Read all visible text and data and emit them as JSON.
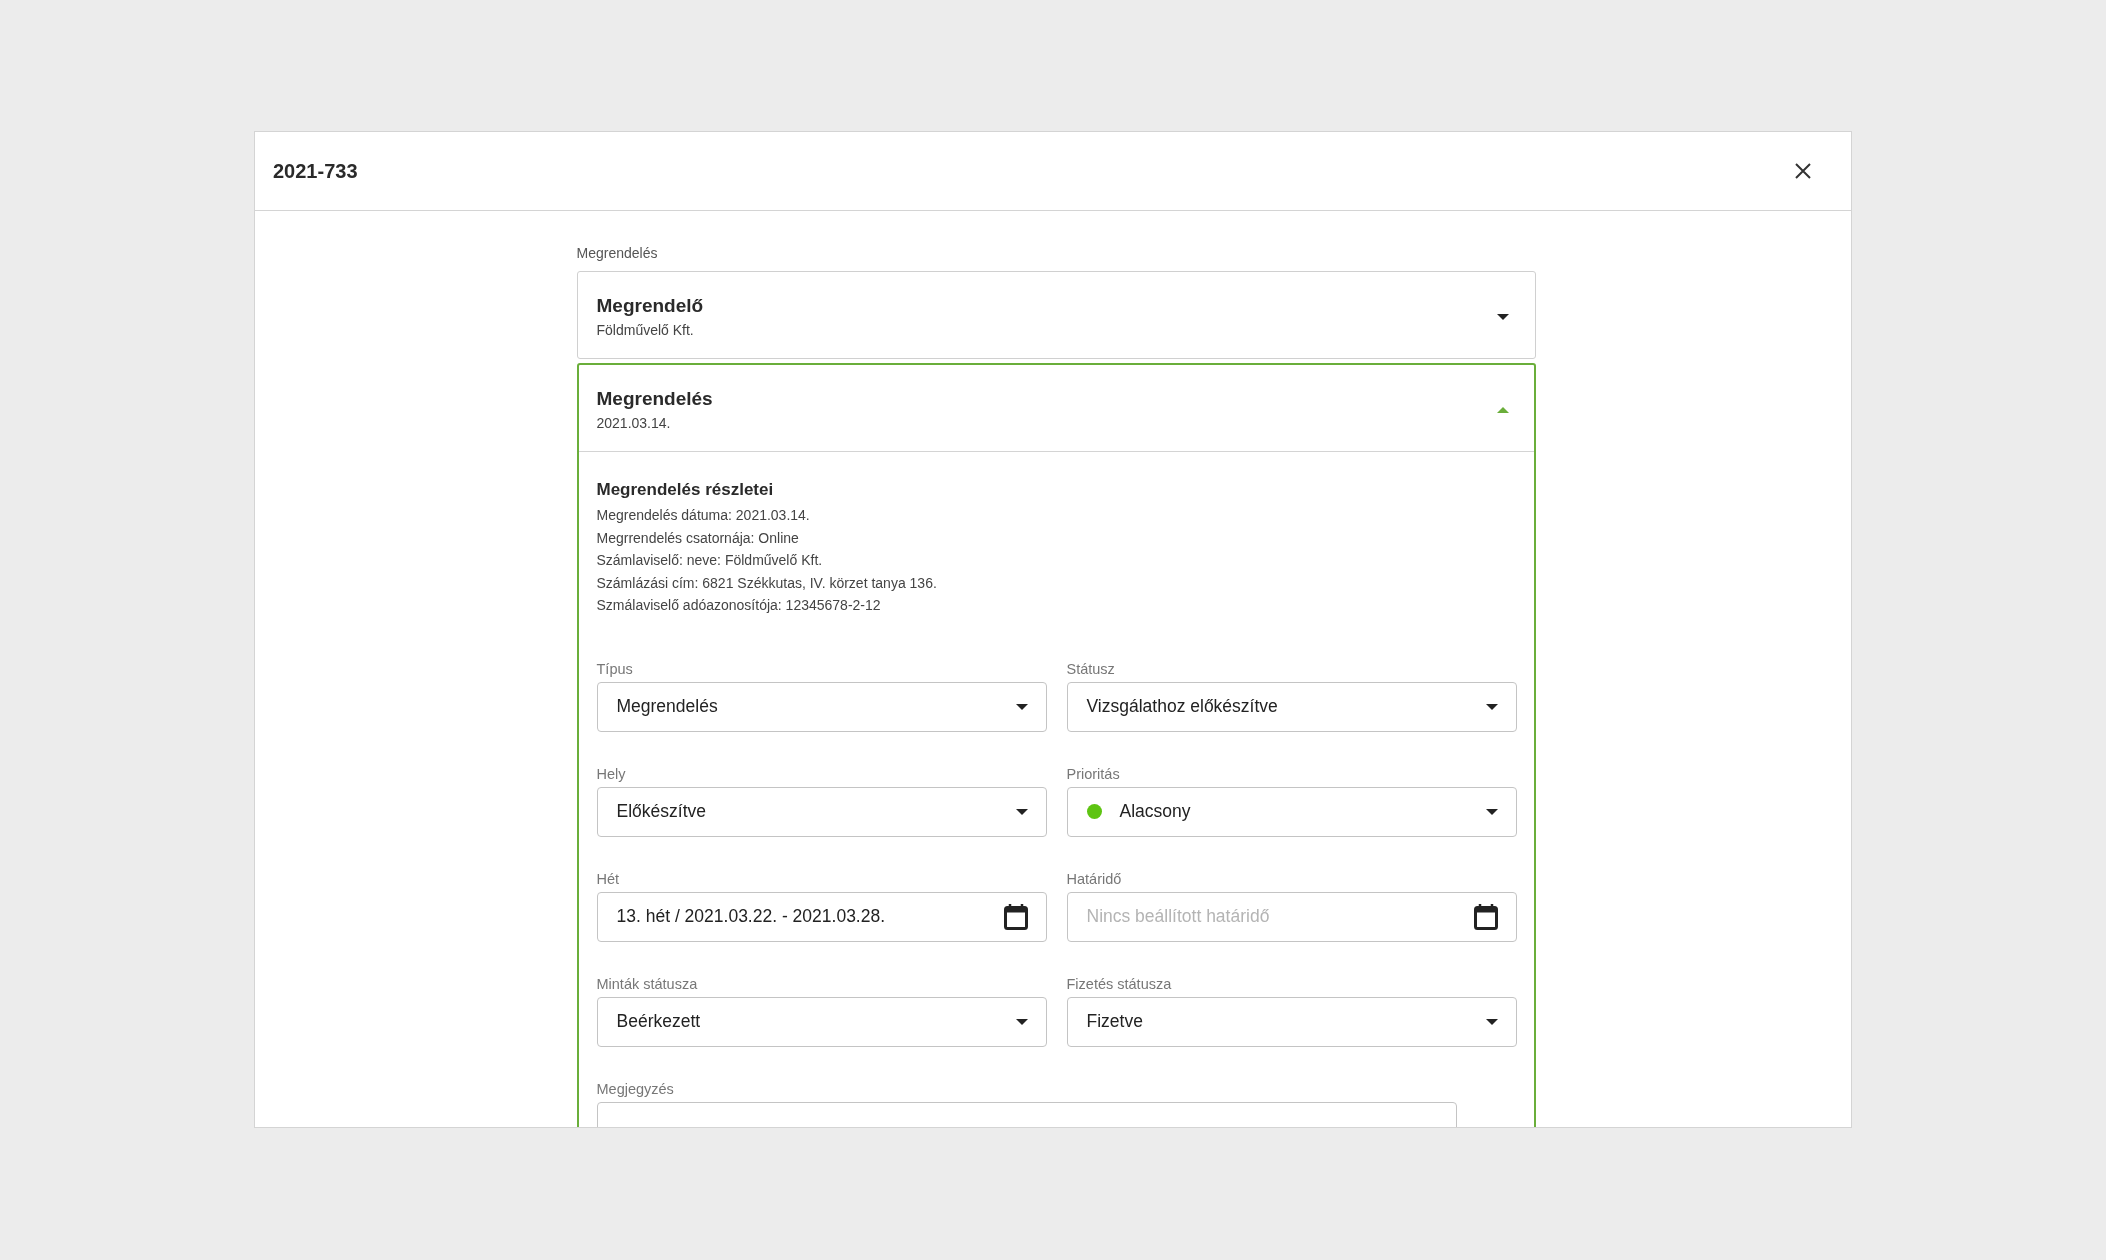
{
  "dialog": {
    "title": "2021-733"
  },
  "section_label": "Megrendelés",
  "panels": [
    {
      "title": "Megrendelő",
      "subtitle": "Földművelő Kft.",
      "expanded": false
    },
    {
      "title": "Megrendelés",
      "subtitle": "2021.03.14.",
      "expanded": true,
      "details": {
        "heading": "Megrendelés részletei",
        "lines": [
          "Megrendelés dátuma: 2021.03.14.",
          "Megrrendelés csatornája: Online",
          "Számlaviselő: neve: Földművelő Kft.",
          "Számlázási cím: 6821 Székkutas, IV. körzet tanya 136.",
          "Szmálaviselő adóazonosítója: 12345678-2-12"
        ]
      },
      "fields": [
        {
          "kind": "select",
          "label": "Típus",
          "value": "Megrendelés"
        },
        {
          "kind": "select",
          "label": "Státusz",
          "value": "Vizsgálathoz előkészítve"
        },
        {
          "kind": "select",
          "label": "Hely",
          "value": "Előkészítve"
        },
        {
          "kind": "select",
          "label": "Prioritás",
          "value": "Alacsony",
          "color": "#5ec412"
        },
        {
          "kind": "date",
          "label": "Hét",
          "value": "13. hét / 2021.03.22. - 2021.03.28."
        },
        {
          "kind": "date",
          "label": "Határidő",
          "placeholder": "Nincs beállított határidő"
        },
        {
          "kind": "select",
          "label": "Minták státusza",
          "value": "Beérkezett"
        },
        {
          "kind": "select",
          "label": "Fizetés státusza",
          "value": "Fizetve"
        },
        {
          "kind": "textarea",
          "label": "Megjegyzés"
        }
      ]
    }
  ]
}
